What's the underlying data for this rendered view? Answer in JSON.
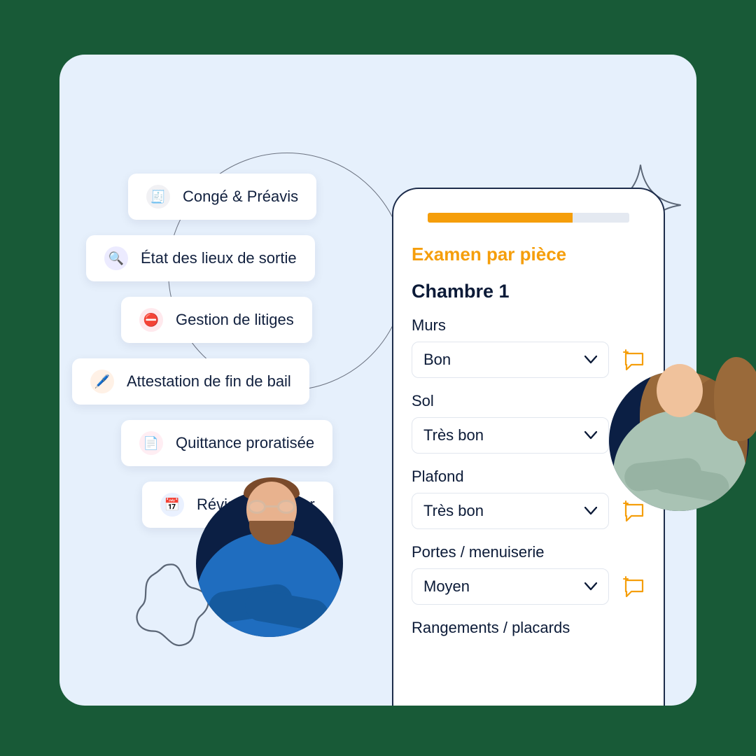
{
  "chips": [
    {
      "label": "Congé & Préavis",
      "icon": "receipt-icon"
    },
    {
      "label": "État des lieux de sortie",
      "icon": "magnifier-icon"
    },
    {
      "label": "Gestion de litiges",
      "icon": "no-entry-icon"
    },
    {
      "label": "Attestation de fin de bail",
      "icon": "pen-icon"
    },
    {
      "label": "Quittance proratisée",
      "icon": "file-icon"
    },
    {
      "label": "Révision du loyer",
      "icon": "calendar-icon"
    }
  ],
  "phone": {
    "progress_percent": 72,
    "section_title": "Examen par pièce",
    "room_title": "Chambre 1",
    "fields": [
      {
        "label": "Murs",
        "value": "Bon"
      },
      {
        "label": "Sol",
        "value": "Très bon"
      },
      {
        "label": "Plafond",
        "value": "Très bon"
      },
      {
        "label": "Portes / menuiserie",
        "value": "Moyen"
      },
      {
        "label": "Rangements / placards",
        "value": ""
      }
    ]
  },
  "colors": {
    "accent": "#f59e0b",
    "navy": "#0b1f44",
    "panel": "#e6f0fc"
  }
}
